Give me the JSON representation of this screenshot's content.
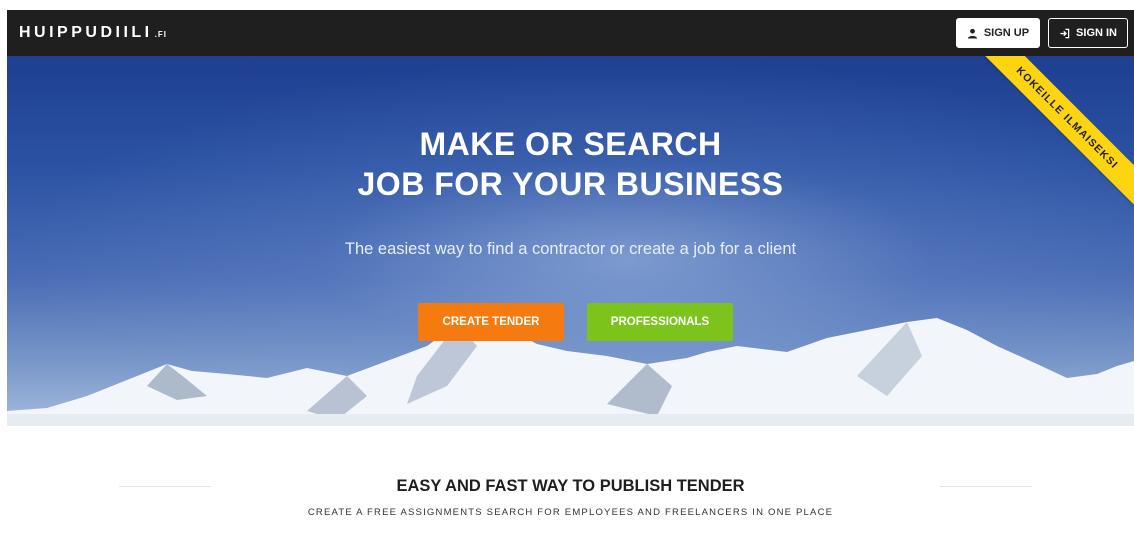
{
  "navbar": {
    "brand": "HUIPPUDIILI",
    "brand_tld": ".FI",
    "signup_label": "SIGN UP",
    "signin_label": "SIGN IN"
  },
  "hero": {
    "title_line1": "MAKE OR SEARCH",
    "title_line2": "JOB FOR YOUR BUSINESS",
    "subtitle": "The easiest way to find a contractor or create a job for a client",
    "create_tender_label": "CREATE TENDER",
    "professionals_label": "PROFESSIONALS",
    "ribbon_label": "KOKEILLE ILMAISEKSI"
  },
  "section": {
    "title": "EASY AND FAST WAY TO PUBLISH TENDER",
    "subtitle": "CREATE A FREE ASSIGNMENTS SEARCH FOR EMPLOYEES AND FREELANCERS IN ONE PLACE"
  },
  "colors": {
    "navbar_bg": "#1f1f1f",
    "create_tender": "#f57b10",
    "professionals": "#7cc41b",
    "ribbon": "#fcd40f",
    "hero_sky": "#2b52a3"
  },
  "icons": {
    "signup": "user-icon",
    "signin": "sign-in-icon"
  }
}
